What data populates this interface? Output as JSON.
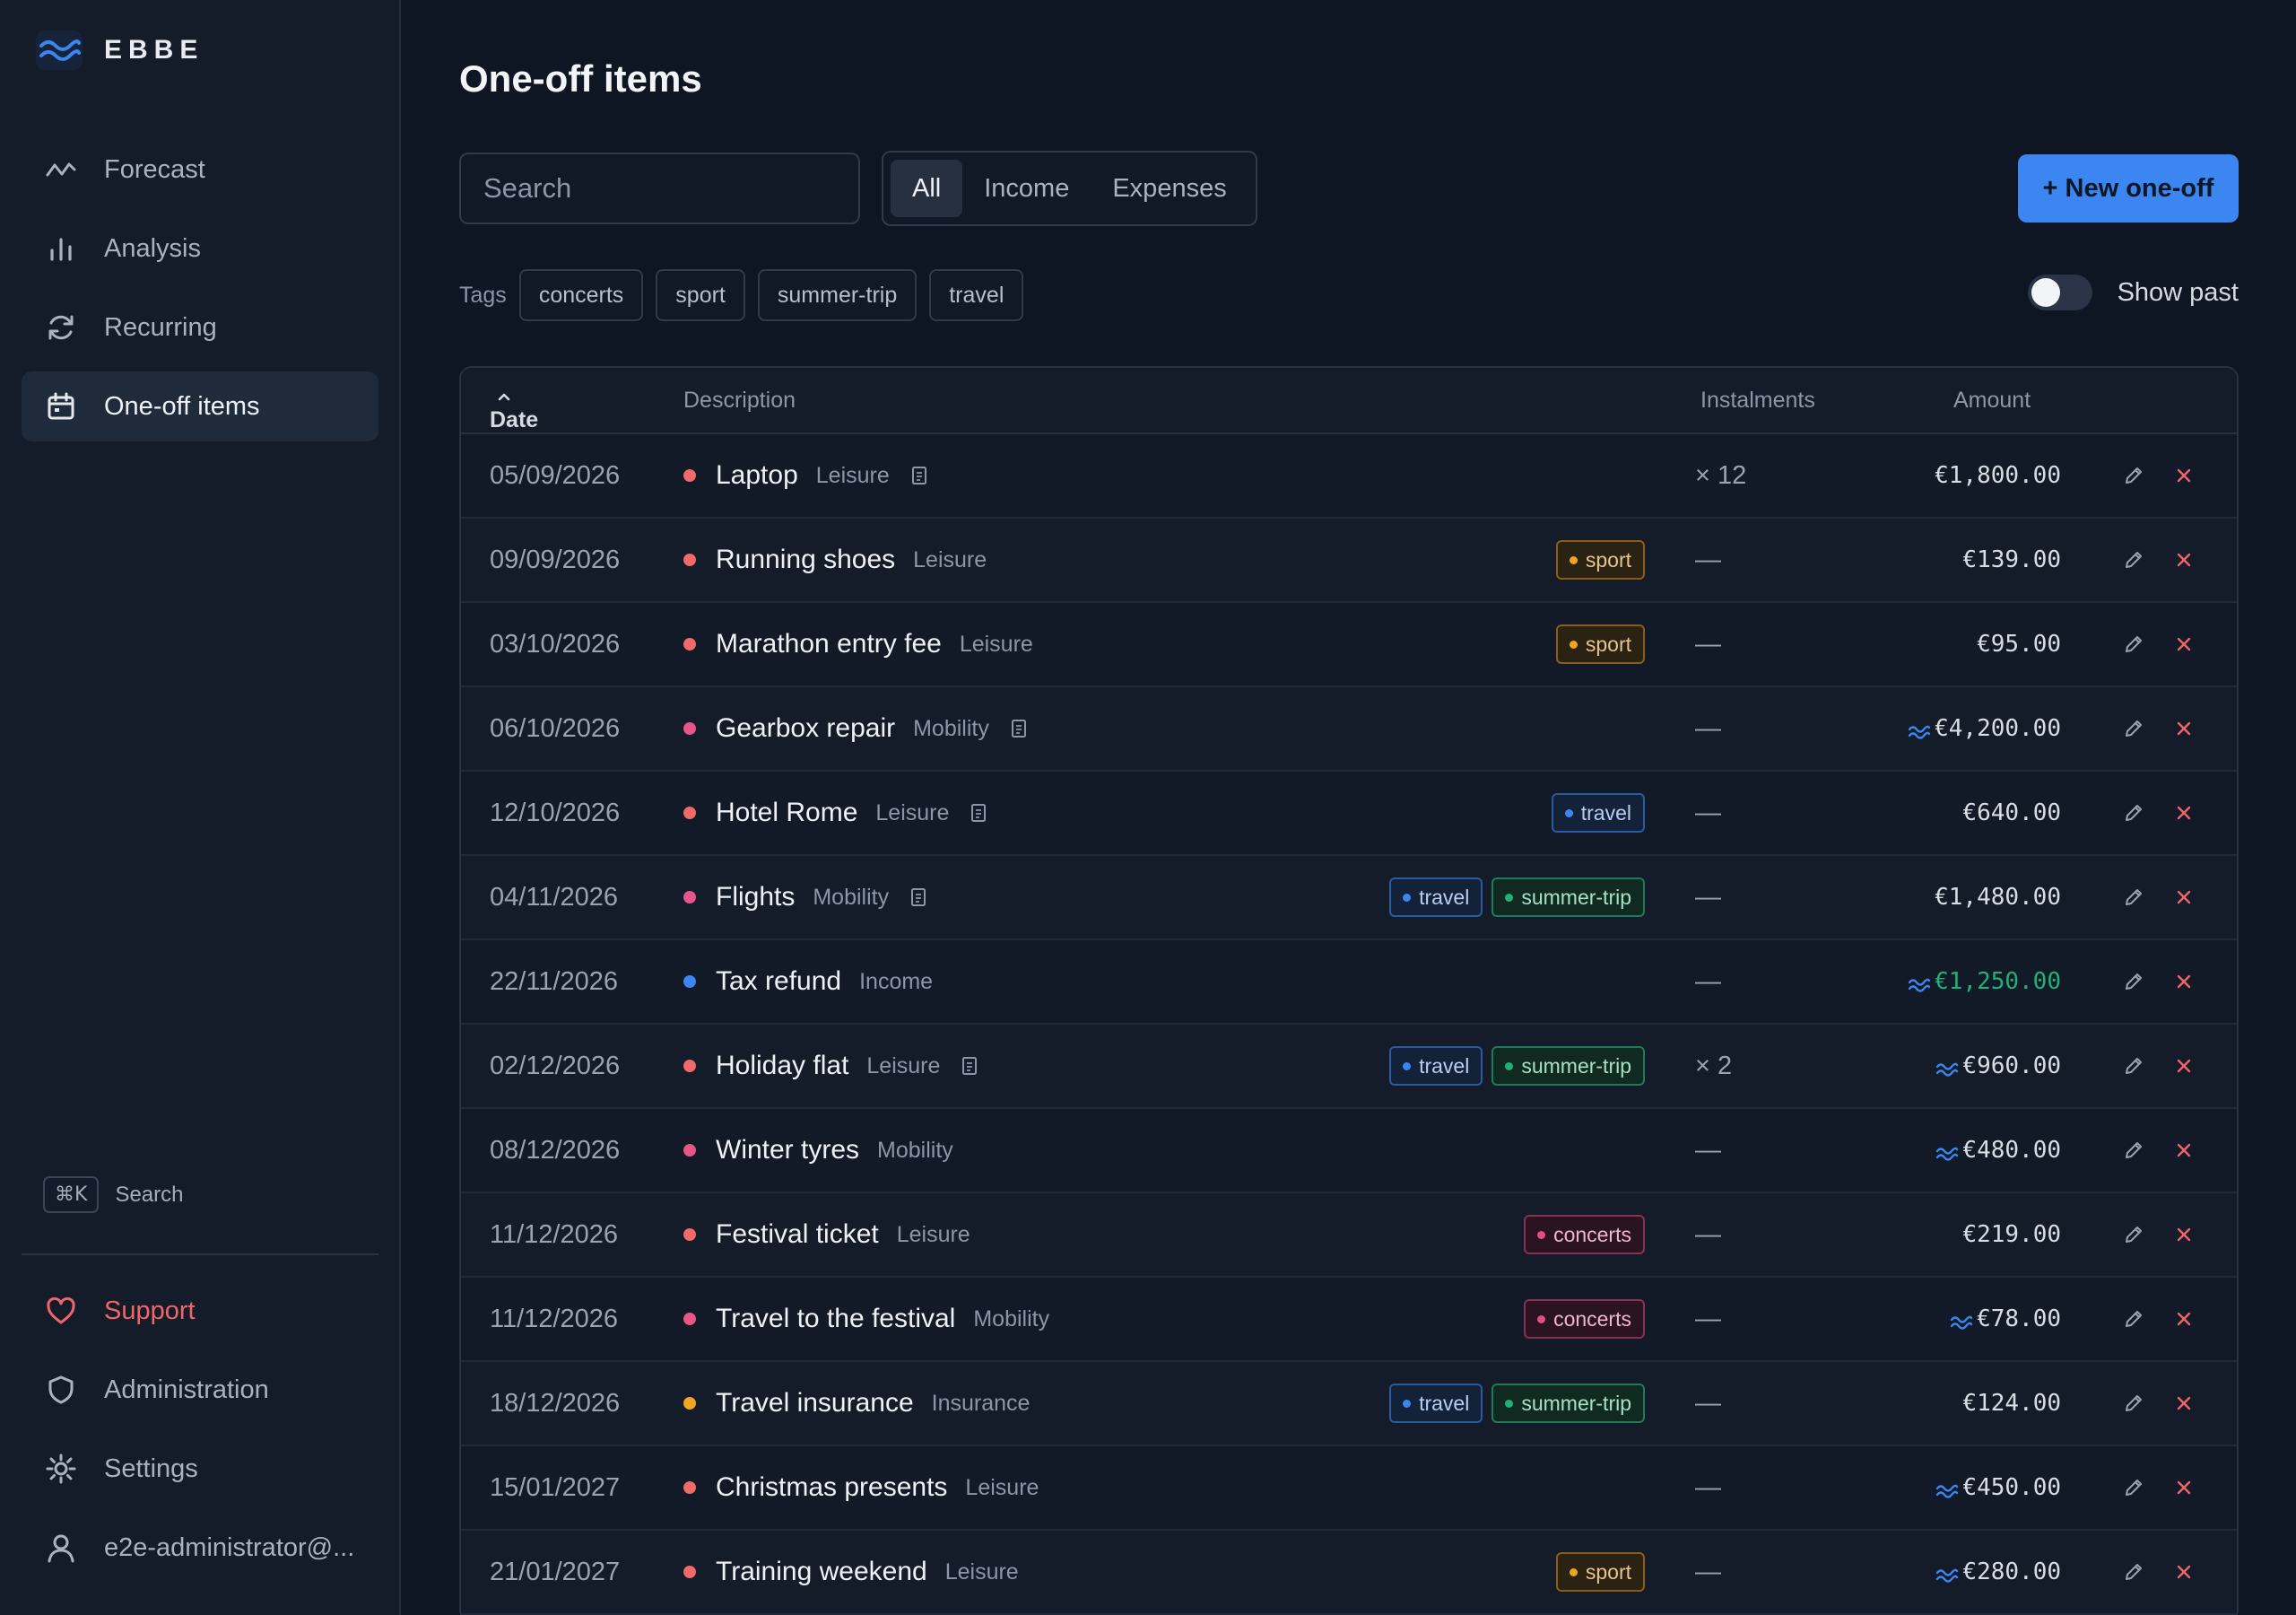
{
  "app": {
    "brand": "EBBE"
  },
  "sidebar": {
    "items": [
      {
        "label": "Forecast",
        "icon": "trend-line-icon"
      },
      {
        "label": "Analysis",
        "icon": "bar-chart-icon"
      },
      {
        "label": "Recurring",
        "icon": "refresh-icon"
      },
      {
        "label": "One-off items",
        "icon": "calendar-icon",
        "active": true
      }
    ],
    "search": {
      "shortcut": "⌘K",
      "label": "Search"
    },
    "bottom": [
      {
        "label": "Support",
        "icon": "heart-icon"
      },
      {
        "label": "Administration",
        "icon": "shield-icon"
      },
      {
        "label": "Settings",
        "icon": "gear-icon"
      },
      {
        "label": "e2e-administrator@...",
        "icon": "user-icon"
      }
    ]
  },
  "main": {
    "title": "One-off items",
    "search_placeholder": "Search",
    "filter": {
      "options": [
        "All",
        "Income",
        "Expenses"
      ],
      "selected": "All"
    },
    "new_button": "+ New one-off",
    "tags_label": "Tags",
    "tags": [
      "concerts",
      "sport",
      "summer-trip",
      "travel"
    ],
    "show_past": {
      "label": "Show past",
      "on": false
    }
  },
  "table": {
    "columns": {
      "date": "Date",
      "description": "Description",
      "instalments": "Instalments",
      "amount": "Amount"
    },
    "rows": [
      {
        "date": "05/09/2026",
        "name": "Laptop",
        "category": "Leisure",
        "dot": "#f06a6a",
        "note": true,
        "tags": [],
        "instalments": "× 12",
        "amount": "€1,800.00",
        "wave": false,
        "income": false
      },
      {
        "date": "09/09/2026",
        "name": "Running shoes",
        "category": "Leisure",
        "dot": "#f06a6a",
        "note": false,
        "tags": [
          "sport"
        ],
        "instalments": "—",
        "amount": "€139.00",
        "wave": false,
        "income": false
      },
      {
        "date": "03/10/2026",
        "name": "Marathon entry fee",
        "category": "Leisure",
        "dot": "#f06a6a",
        "note": false,
        "tags": [
          "sport"
        ],
        "instalments": "—",
        "amount": "€95.00",
        "wave": false,
        "income": false
      },
      {
        "date": "06/10/2026",
        "name": "Gearbox repair",
        "category": "Mobility",
        "dot": "#e8558a",
        "note": true,
        "tags": [],
        "instalments": "—",
        "amount": "€4,200.00",
        "wave": true,
        "income": false
      },
      {
        "date": "12/10/2026",
        "name": "Hotel Rome",
        "category": "Leisure",
        "dot": "#f06a6a",
        "note": true,
        "tags": [
          "travel"
        ],
        "instalments": "—",
        "amount": "€640.00",
        "wave": false,
        "income": false
      },
      {
        "date": "04/11/2026",
        "name": "Flights",
        "category": "Mobility",
        "dot": "#e8558a",
        "note": true,
        "tags": [
          "travel",
          "summer-trip"
        ],
        "instalments": "—",
        "amount": "€1,480.00",
        "wave": false,
        "income": false
      },
      {
        "date": "22/11/2026",
        "name": "Tax refund",
        "category": "Income",
        "dot": "#3b86f0",
        "note": false,
        "tags": [],
        "instalments": "—",
        "amount": "€1,250.00",
        "wave": true,
        "income": true
      },
      {
        "date": "02/12/2026",
        "name": "Holiday flat",
        "category": "Leisure",
        "dot": "#f06a6a",
        "note": true,
        "tags": [
          "travel",
          "summer-trip"
        ],
        "instalments": "× 2",
        "amount": "€960.00",
        "wave": true,
        "income": false
      },
      {
        "date": "08/12/2026",
        "name": "Winter tyres",
        "category": "Mobility",
        "dot": "#e8558a",
        "note": false,
        "tags": [],
        "instalments": "—",
        "amount": "€480.00",
        "wave": true,
        "income": false
      },
      {
        "date": "11/12/2026",
        "name": "Festival ticket",
        "category": "Leisure",
        "dot": "#f06a6a",
        "note": false,
        "tags": [
          "concerts"
        ],
        "instalments": "—",
        "amount": "€219.00",
        "wave": false,
        "income": false
      },
      {
        "date": "11/12/2026",
        "name": "Travel to the festival",
        "category": "Mobility",
        "dot": "#e8558a",
        "note": false,
        "tags": [
          "concerts"
        ],
        "instalments": "—",
        "amount": "€78.00",
        "wave": true,
        "income": false
      },
      {
        "date": "18/12/2026",
        "name": "Travel insurance",
        "category": "Insurance",
        "dot": "#f0a524",
        "note": false,
        "tags": [
          "travel",
          "summer-trip"
        ],
        "instalments": "—",
        "amount": "€124.00",
        "wave": false,
        "income": false
      },
      {
        "date": "15/01/2027",
        "name": "Christmas presents",
        "category": "Leisure",
        "dot": "#f06a6a",
        "note": false,
        "tags": [],
        "instalments": "—",
        "amount": "€450.00",
        "wave": true,
        "income": false
      },
      {
        "date": "21/01/2027",
        "name": "Training weekend",
        "category": "Leisure",
        "dot": "#f06a6a",
        "note": false,
        "tags": [
          "sport"
        ],
        "instalments": "—",
        "amount": "€280.00",
        "wave": true,
        "income": false
      }
    ]
  },
  "colors": {
    "accent": "#3b86f0",
    "danger": "#f0656a",
    "income": "#22b07a",
    "background": "#0f1623"
  }
}
